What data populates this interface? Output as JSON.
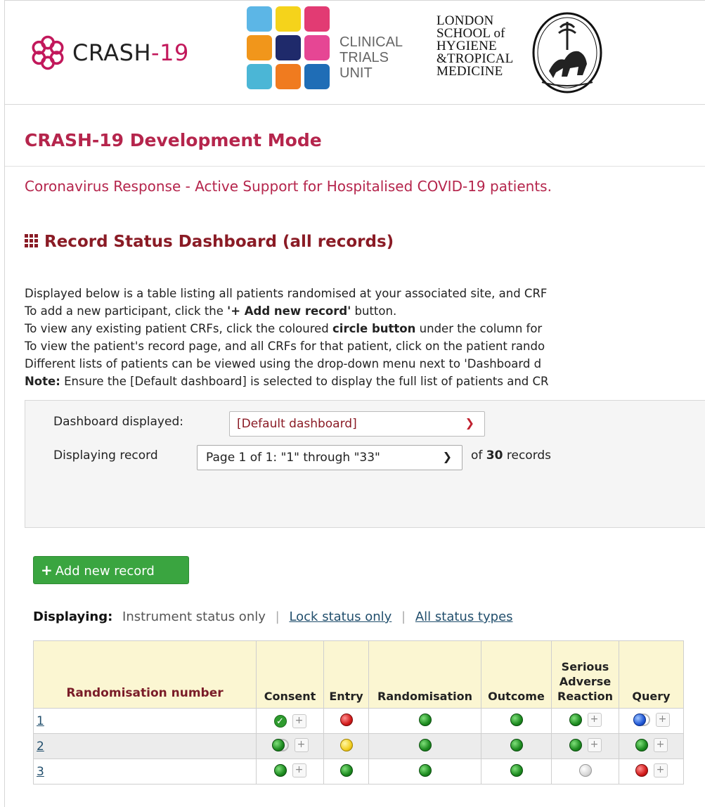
{
  "logos": {
    "crash_prefix": "CRASH",
    "crash_dash": "-",
    "crash_num": "19",
    "ctu_lines": [
      "CLINICAL",
      "TRIALS",
      "UNIT"
    ],
    "lshtm_lines": [
      "LONDON",
      "SCHOOL of",
      "HYGIENE",
      "&TROPICAL",
      "MEDICINE"
    ]
  },
  "project_title": "CRASH-19 Development Mode",
  "project_subtitle": "Coronavirus Response - Active Support for Hospitalised COVID-19 patients.",
  "dashboard_heading": "Record Status Dashboard (all records)",
  "info": {
    "line1": "Displayed below is a table listing all patients randomised at your associated site, and CRF",
    "line2_pre": "To add a new participant, click the ",
    "line2_bold": "'+ Add new record'",
    "line2_post": " button.",
    "line3_pre": "To view any existing patient CRFs, click the coloured ",
    "line3_bold": "circle button",
    "line3_post": " under the column for",
    "line4": "To view the patient's record page, and all CRFs for that patient, click on the patient rando",
    "line5": "Different lists of patients can be viewed using the drop-down menu next to 'Dashboard d",
    "line6_bold": "Note:",
    "line6_post": " Ensure the [Default dashboard] is selected to display the full list of patients and CR"
  },
  "filters": {
    "dashboard_label": "Dashboard displayed:",
    "dashboard_value": "[Default dashboard]",
    "record_label": "Displaying record",
    "record_value": "Page 1 of 1: \"1\" through \"33\"",
    "of_text": "of",
    "record_count": "30",
    "records_text": "records"
  },
  "add_button": "Add new record",
  "displaying": {
    "label": "Displaying:",
    "option_current": "Instrument status only",
    "option_lock": "Lock status only",
    "option_all": "All status types"
  },
  "table": {
    "headers": {
      "rand": "Randomisation number",
      "consent": "Consent",
      "entry": "Entry",
      "randomisation": "Randomisation",
      "outcome": "Outcome",
      "sar_line1": "Serious",
      "sar_line2": "Adverse",
      "sar_line3": "Reaction",
      "query": "Query"
    },
    "rows": [
      {
        "id": "1",
        "consent": "complete-check",
        "entry": "red",
        "randomisation": "green",
        "outcome": "green",
        "sar": "green",
        "query": "blue-multi"
      },
      {
        "id": "2",
        "consent": "green-multi",
        "entry": "yellow",
        "randomisation": "green",
        "outcome": "green",
        "sar": "green",
        "query": "green"
      },
      {
        "id": "3",
        "consent": "green",
        "entry": "green",
        "randomisation": "green",
        "outcome": "green",
        "sar": "gray",
        "query": "red"
      }
    ]
  },
  "colors": {
    "brand_pink": "#b5254c",
    "heading_maroon": "#8a1b25",
    "add_green": "#3aa540",
    "header_bg": "#fbf6d2"
  }
}
